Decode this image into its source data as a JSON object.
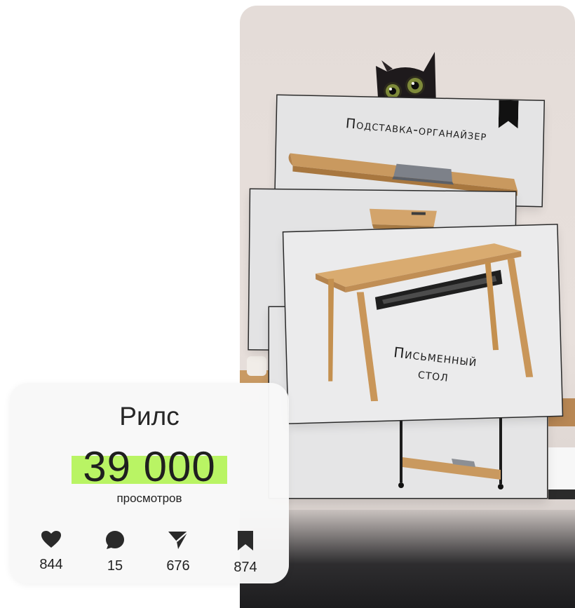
{
  "reel_preview": {
    "card_top_caption": "Подставка-органайзер",
    "card_front_caption_line1": "Письменный",
    "card_front_caption_line2": "стол"
  },
  "stats": {
    "title": "Рилс",
    "views_value": "39 000",
    "views_label": "просмотров",
    "metrics": [
      {
        "icon": "heart-icon",
        "value": "844"
      },
      {
        "icon": "comment-icon",
        "value": "15"
      },
      {
        "icon": "send-icon",
        "value": "676"
      },
      {
        "icon": "bookmark-icon",
        "value": "874"
      }
    ]
  },
  "colors": {
    "highlight": "#b9f464",
    "card_background": "#f8f8f8",
    "text": "#222222"
  }
}
